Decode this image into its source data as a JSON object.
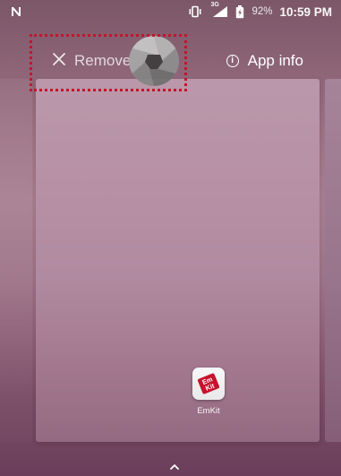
{
  "status_bar": {
    "left_icon": "nfc-icon",
    "vibrate_icon": "vibrate-icon",
    "network_label": "3G",
    "battery_percent": "92%",
    "time": "10:59 PM"
  },
  "actions": {
    "remove_label": "Remove",
    "app_info_label": "App info"
  },
  "app": {
    "name": "EmKit",
    "icon": "emkit-app-icon",
    "icon_text_top": "Em",
    "icon_text_bottom": "Kit",
    "brand_color": "#c8112c"
  },
  "highlight_color": "#c3152c",
  "navigation": {
    "overview_handle_icon": "chevron-up-icon"
  }
}
